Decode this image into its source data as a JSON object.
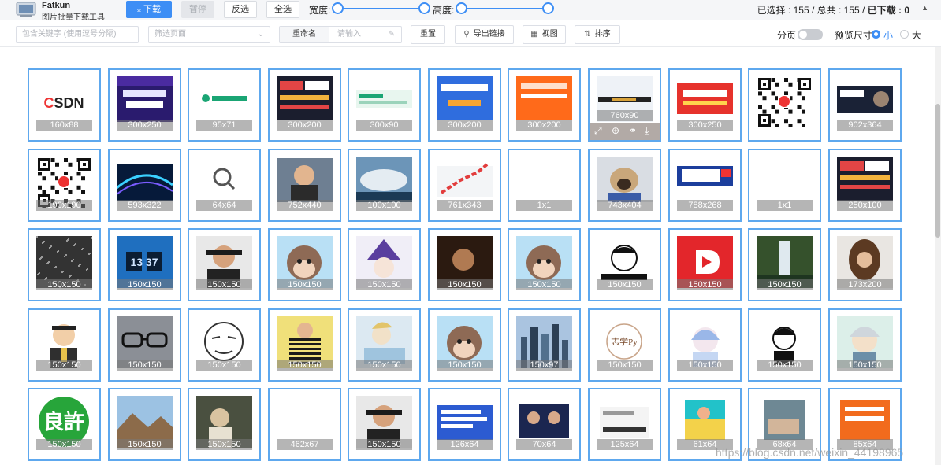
{
  "header": {
    "brand_name": "Fatkun",
    "brand_sub": "图片批量下载工具",
    "download_label": "下载",
    "pause_label": "暂停",
    "invert_label": "反选",
    "select_all_label": "全选",
    "width_label": "宽度:",
    "height_label": "高度:",
    "stats_selected": "已选择 : 155 / 总共 : 155 / ",
    "stats_downloaded": "已下载 : 0"
  },
  "toolbar": {
    "keyword_placeholder": "包含关键字 (使用逗号分隔)",
    "page_filter_placeholder": "筛选页面",
    "rename_label": "重命名",
    "rename_placeholder": "请输入",
    "reset_label": "重置",
    "export_label": "导出链接",
    "view_label": "视图",
    "sort_label": "排序",
    "paging_label": "分页",
    "preview_size_label": "预览尺寸",
    "size_small": "小",
    "size_large": "大"
  },
  "colors": {
    "accent": "#3d8ef5",
    "card_border": "#5ea8ee"
  },
  "images": [
    {
      "dim": "160x88",
      "kind": "csdn-logo"
    },
    {
      "dim": "300x250",
      "kind": "csdn-banner"
    },
    {
      "dim": "95x71",
      "kind": "jumpserver"
    },
    {
      "dim": "300x200",
      "kind": "red-promo"
    },
    {
      "dim": "300x90",
      "kind": "jumpserver-banner"
    },
    {
      "dim": "300x200",
      "kind": "blue-ad"
    },
    {
      "dim": "300x200",
      "kind": "orange-ad"
    },
    {
      "dim": "760x90",
      "kind": "thin-banner",
      "hover": true
    },
    {
      "dim": "300x250",
      "kind": "red-server-ad"
    },
    {
      "dim": "",
      "kind": "qr-code"
    },
    {
      "dim": "902x364",
      "kind": "dark-banner"
    },
    {
      "dim": "190x190",
      "kind": "qr-code-csdn"
    },
    {
      "dim": "593x322",
      "kind": "abstract-blue"
    },
    {
      "dim": "64x64",
      "kind": "search-icon"
    },
    {
      "dim": "752x440",
      "kind": "portrait"
    },
    {
      "dim": "100x100",
      "kind": "sky"
    },
    {
      "dim": "761x343",
      "kind": "red-chart"
    },
    {
      "dim": "1x1",
      "kind": "blank"
    },
    {
      "dim": "743x404",
      "kind": "pug"
    },
    {
      "dim": "788x268",
      "kind": "dakaa-banner"
    },
    {
      "dim": "1x1",
      "kind": "blank"
    },
    {
      "dim": "250x100",
      "kind": "red-promo-wide"
    },
    {
      "dim": "150x150",
      "kind": "dark-noise"
    },
    {
      "dim": "150x150",
      "kind": "clock-1337"
    },
    {
      "dim": "150x150",
      "kind": "young-man"
    },
    {
      "dim": "150x150",
      "kind": "monkey"
    },
    {
      "dim": "150x150",
      "kind": "witch"
    },
    {
      "dim": "150x150",
      "kind": "dark-photo"
    },
    {
      "dim": "150x150",
      "kind": "monkey"
    },
    {
      "dim": "150x150",
      "kind": "meme-girl"
    },
    {
      "dim": "150x150",
      "kind": "red-d-logo"
    },
    {
      "dim": "150x150",
      "kind": "waterfall"
    },
    {
      "dim": "173x200",
      "kind": "long-hair"
    },
    {
      "dim": "150x150",
      "kind": "cartoon-man"
    },
    {
      "dim": "150x150",
      "kind": "glasses"
    },
    {
      "dim": "150x150",
      "kind": "sketch-face"
    },
    {
      "dim": "150x150",
      "kind": "yellow-stripes"
    },
    {
      "dim": "150x150",
      "kind": "anime-sketch"
    },
    {
      "dim": "150x150",
      "kind": "monkey"
    },
    {
      "dim": "150x97",
      "kind": "city"
    },
    {
      "dim": "150x150",
      "kind": "py-logo"
    },
    {
      "dim": "150x150",
      "kind": "blue-hair-girl"
    },
    {
      "dim": "150x150",
      "kind": "manga-girl"
    },
    {
      "dim": "150x150",
      "kind": "gintoki"
    },
    {
      "dim": "150x150",
      "kind": "green-circle"
    },
    {
      "dim": "150x150",
      "kind": "landscape"
    },
    {
      "dim": "150x150",
      "kind": "ancient-art"
    },
    {
      "dim": "462x67",
      "kind": "blank"
    },
    {
      "dim": "150x150",
      "kind": "man-portrait"
    },
    {
      "dim": "126x64",
      "kind": "blue-article"
    },
    {
      "dim": "70x64",
      "kind": "two-people"
    },
    {
      "dim": "125x64",
      "kind": "automl"
    },
    {
      "dim": "61x64",
      "kind": "colorful-girl"
    },
    {
      "dim": "68x64",
      "kind": "office"
    },
    {
      "dim": "85x64",
      "kind": "orange-course"
    }
  ],
  "watermark": "https://blog.csdn.net/weixin_44198965"
}
